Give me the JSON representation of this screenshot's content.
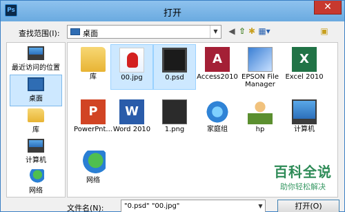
{
  "window": {
    "title": "打开",
    "app_icon": "Ps",
    "close_glyph": "✕"
  },
  "toolbar": {
    "look_in_label": "查找范围(I):",
    "look_in_value": "桌面",
    "back_icon": "◀",
    "up_icon": "⇧",
    "new_folder_icon": "✱",
    "view_icon": "▦▾",
    "dropdown_arrow": "▼",
    "right_icon": "▣"
  },
  "places": [
    {
      "label": "最近访问的位置",
      "icon": "recent-icon"
    },
    {
      "label": "桌面",
      "icon": "desktop-icon",
      "selected": true
    },
    {
      "label": "库",
      "icon": "library-icon"
    },
    {
      "label": "计算机",
      "icon": "computer-icon"
    },
    {
      "label": "网络",
      "icon": "network-icon"
    }
  ],
  "files": [
    {
      "label": "库",
      "icon": "folder-icon"
    },
    {
      "label": "00.jpg",
      "icon": "image-spiderman-icon",
      "selected": true
    },
    {
      "label": "0.psd",
      "icon": "psd-monitor-icon",
      "selected": true
    },
    {
      "label": "Access2010",
      "icon": "access-icon",
      "glyph": "A"
    },
    {
      "label": "EPSON File Manager",
      "icon": "epson-icon"
    },
    {
      "label": "Excel 2010",
      "icon": "excel-icon",
      "glyph": "X"
    },
    {
      "label": "PowerPnt...",
      "icon": "powerpoint-icon",
      "glyph": "P"
    },
    {
      "label": "Word 2010",
      "icon": "word-icon",
      "glyph": "W"
    },
    {
      "label": "1.png",
      "icon": "png-dark-icon"
    },
    {
      "label": "家庭组",
      "icon": "homegroup-icon"
    },
    {
      "label": "hp",
      "icon": "user-folder-icon"
    },
    {
      "label": "计算机",
      "icon": "computer-icon"
    },
    {
      "label": "网络",
      "icon": "network-icon"
    }
  ],
  "watermark": {
    "title": "百科全说",
    "subtitle": "助你轻松解决"
  },
  "filename": {
    "label": "文件名(N):",
    "value": "\"0.psd\" \"00.jpg\"",
    "dropdown_arrow": "▼"
  },
  "buttons": {
    "open_label": "打开(O)"
  }
}
